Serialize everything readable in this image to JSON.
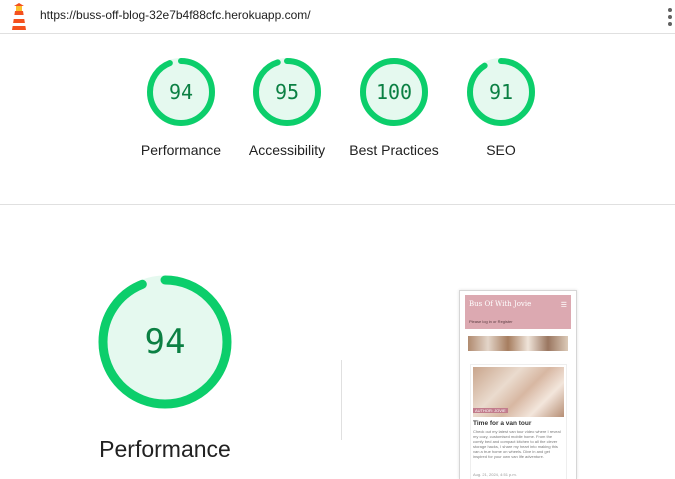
{
  "topbar": {
    "url": "https://buss-off-blog-32e7b4f88cfc.herokuapp.com/",
    "logo_icon": "lighthouse-icon",
    "menu_icon": "vertical-dots-icon"
  },
  "colors": {
    "pass_ring": "#0cce6b",
    "pass_fill": "#e5f9ef",
    "pass_text": "#0b8043",
    "thumb_header": "#dca9b1"
  },
  "categories": [
    {
      "label": "Performance",
      "score": "94",
      "fraction": 0.94
    },
    {
      "label": "Accessibility",
      "score": "95",
      "fraction": 0.95
    },
    {
      "label": "Best Practices",
      "score": "100",
      "fraction": 1.0
    },
    {
      "label": "SEO",
      "score": "91",
      "fraction": 0.91
    }
  ],
  "detail": {
    "score": "94",
    "fraction": 0.94,
    "label": "Performance"
  },
  "thumbnail": {
    "brand": "Bus Of With Jovie",
    "menu_icon": "hamburger-icon",
    "login_text": "Please log in or Register",
    "tag": "AUTHOR: JOVIE",
    "post_title": "Time for a van tour",
    "excerpt": "Check out my latest van tour video where I reveal my cozy, customised mobile home. From the comfy bed and compact kitchen to all the clever storage hacks, I share my heart into making this van a true home on wheels. Dive in and get inspired for your own van life adventure.",
    "date": "Aug. 21, 2024, 4:51 p.m."
  }
}
